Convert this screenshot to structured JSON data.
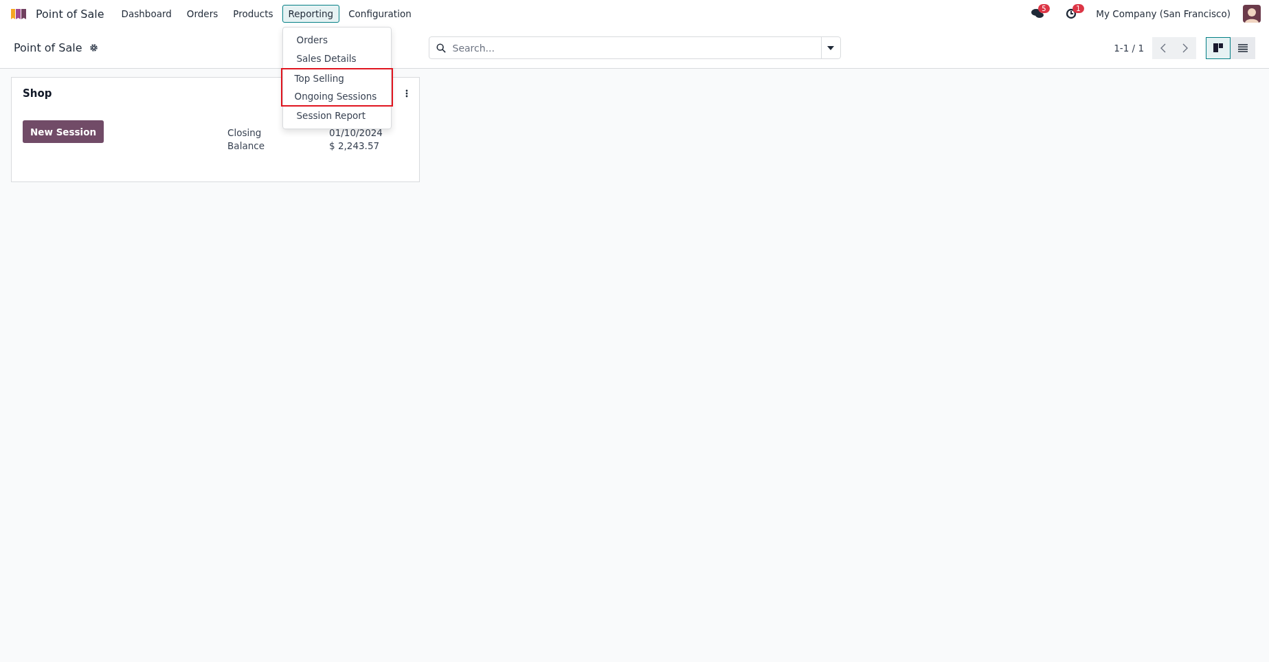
{
  "navbar": {
    "app_name": "Point of Sale",
    "menus": [
      {
        "label": "Dashboard",
        "selected": false
      },
      {
        "label": "Orders",
        "selected": false
      },
      {
        "label": "Products",
        "selected": false
      },
      {
        "label": "Reporting",
        "selected": true
      },
      {
        "label": "Configuration",
        "selected": false
      }
    ],
    "messages_count": "5",
    "activities_count": "1",
    "company": "My Company (San Francisco)"
  },
  "dropdown": {
    "items": [
      {
        "label": "Orders",
        "highlighted": false
      },
      {
        "label": "Sales Details",
        "highlighted": false
      },
      {
        "label": "Top Selling",
        "highlighted": true
      },
      {
        "label": "Ongoing Sessions",
        "highlighted": true
      },
      {
        "label": "Session Report",
        "highlighted": false
      }
    ]
  },
  "control_panel": {
    "title": "Point of Sale",
    "search": {
      "placeholder": "Search..."
    },
    "pager": "1-1 / 1",
    "views": [
      {
        "kind": "kanban",
        "selected": true
      },
      {
        "kind": "list",
        "selected": false
      }
    ]
  },
  "cards": [
    {
      "title": "Shop",
      "button": "New Session",
      "fields": [
        {
          "label": "Closing",
          "value": "01/10/2024"
        },
        {
          "label": "Balance",
          "value": "$ 2,243.57"
        }
      ]
    }
  ]
}
